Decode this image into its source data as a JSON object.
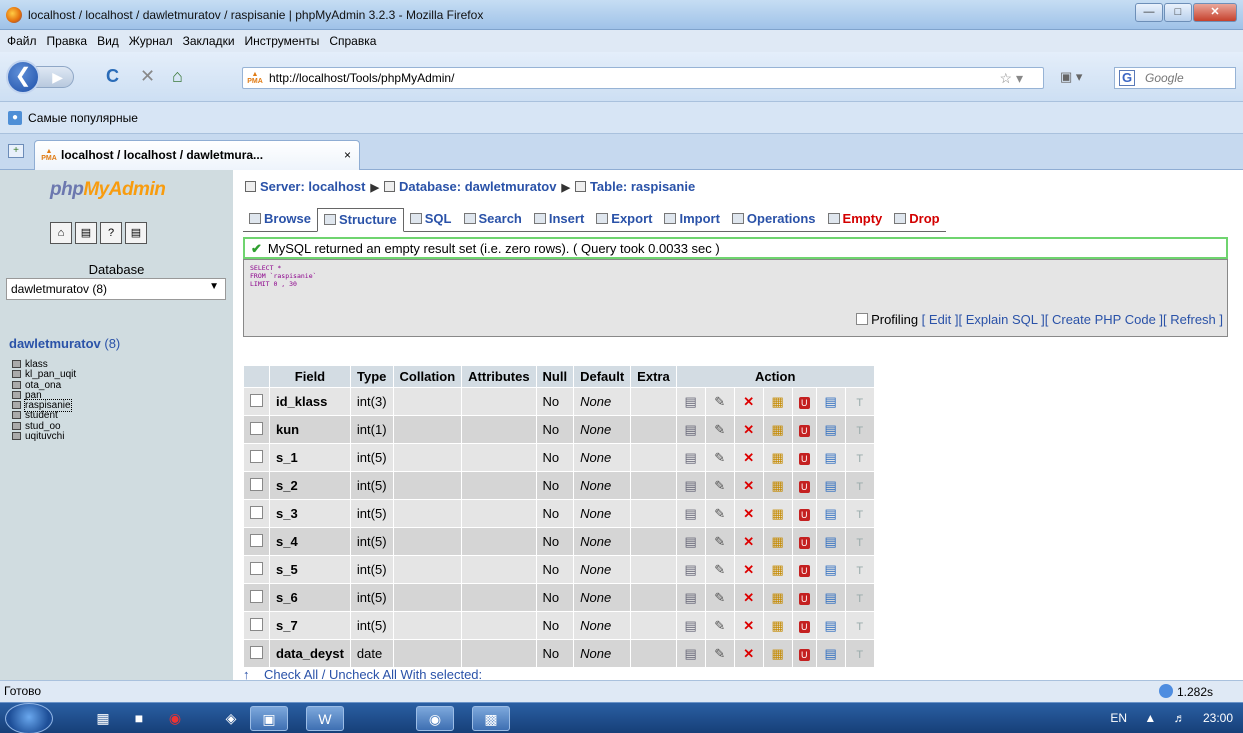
{
  "window": {
    "title": "localhost / localhost / dawletmuratov / raspisanie | phpMyAdmin 3.2.3 - Mozilla Firefox"
  },
  "menu": [
    "Файл",
    "Правка",
    "Вид",
    "Журнал",
    "Закладки",
    "Инструменты",
    "Справка"
  ],
  "nav": {
    "url": "http://localhost/Tools/phpMyAdmin/",
    "search_placeholder": "Google"
  },
  "bookmarks": {
    "label": "Самые популярные"
  },
  "browser_tab": {
    "title": "localhost / localhost / dawletmura..."
  },
  "left": {
    "logo_a": "php",
    "logo_b": "MyAdmin",
    "db_label": "Database",
    "db_select": "dawletmuratov (8)",
    "db_title": "dawletmuratov",
    "db_count": "(8)",
    "tables": [
      "klass",
      "kl_pan_uqit",
      "ota_ona",
      "pan",
      "raspisanie",
      "student",
      "stud_oo",
      "uqituvchi"
    ]
  },
  "breadcrumb": {
    "server": "Server: localhost",
    "database": "Database: dawletmuratov",
    "table": "Table: raspisanie"
  },
  "tabs": [
    "Browse",
    "Structure",
    "SQL",
    "Search",
    "Insert",
    "Export",
    "Import",
    "Operations",
    "Empty",
    "Drop"
  ],
  "notice": "MySQL returned an empty result set (i.e. zero rows). ( Query took 0.0033 sec )",
  "sql": {
    "line1": "SELECT *",
    "line2": "FROM `raspisanie`",
    "line3": "LIMIT 0 , 30",
    "profiling": "Profiling",
    "edit": "[ Edit ]",
    "explain": "[ Explain SQL ]",
    "php": "[ Create PHP Code ]",
    "refresh": "[ Refresh ]"
  },
  "structure": {
    "headers": [
      "Field",
      "Type",
      "Collation",
      "Attributes",
      "Null",
      "Default",
      "Extra",
      "Action"
    ],
    "rows": [
      {
        "field": "id_klass",
        "type": "int(3)",
        "null": "No",
        "default": "None"
      },
      {
        "field": "kun",
        "type": "int(1)",
        "null": "No",
        "default": "None"
      },
      {
        "field": "s_1",
        "type": "int(5)",
        "null": "No",
        "default": "None"
      },
      {
        "field": "s_2",
        "type": "int(5)",
        "null": "No",
        "default": "None"
      },
      {
        "field": "s_3",
        "type": "int(5)",
        "null": "No",
        "default": "None"
      },
      {
        "field": "s_4",
        "type": "int(5)",
        "null": "No",
        "default": "None"
      },
      {
        "field": "s_5",
        "type": "int(5)",
        "null": "No",
        "default": "None"
      },
      {
        "field": "s_6",
        "type": "int(5)",
        "null": "No",
        "default": "None"
      },
      {
        "field": "s_7",
        "type": "int(5)",
        "null": "No",
        "default": "None"
      },
      {
        "field": "data_deyst",
        "type": "date",
        "null": "No",
        "default": "None"
      }
    ],
    "bottom": "Check All / Uncheck All With selected:"
  },
  "status": {
    "text": "Готово",
    "time": "1.282s"
  },
  "taskbar": {
    "lang": "EN",
    "clock": "23:00"
  }
}
